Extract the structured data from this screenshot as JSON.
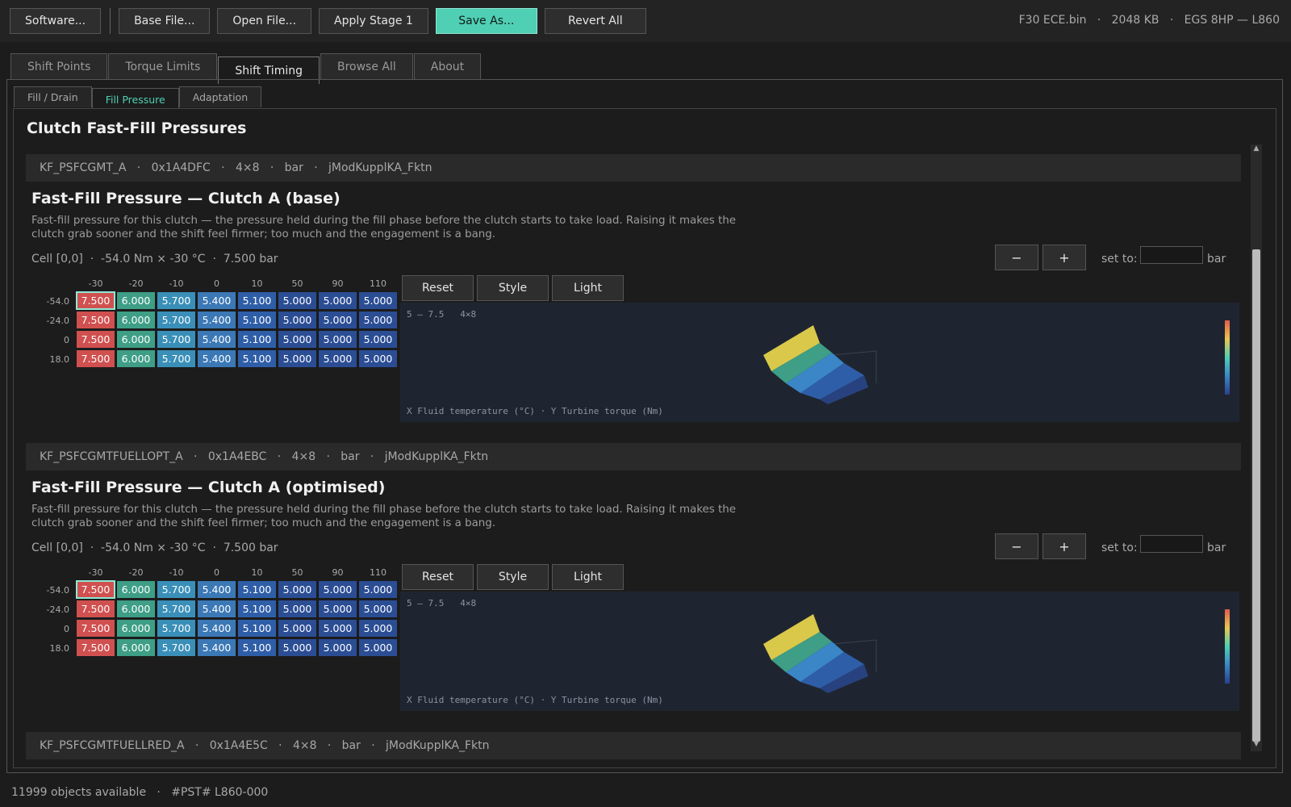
{
  "toolbar": {
    "software": "Software...",
    "base_file": "Base File...",
    "open_file": "Open File...",
    "apply_stage1": "Apply Stage 1",
    "save_as": "Save As...",
    "revert_all": "Revert All",
    "file_info": "F30 ECE.bin   ·   2048 KB   ·   EGS 8HP — L860",
    "accent": "#4fcfb3"
  },
  "tabs": [
    "Shift Points",
    "Torque Limits",
    "Shift Timing",
    "Browse All",
    "About"
  ],
  "active_tab": "Shift Timing",
  "subtabs": [
    "Fill / Drain",
    "Fill Pressure",
    "Adaptation"
  ],
  "active_subtab": "Fill Pressure",
  "page_title": "Clutch Fast-Fill Pressures",
  "maps": [
    {
      "header": "KF_PSFCGMT_A   ·   0x1A4DFC   ·   4×8   ·   bar   ·   jModKupplKA_Fktn",
      "title": "Fast-Fill Pressure — Clutch A (base)",
      "description": "Fast-fill pressure for this clutch — the pressure held during the fill phase before the clutch starts to take load. Raising it makes the clutch grab sooner and the shift feel firmer; too much and the engagement is a bang.",
      "cell_info": "Cell [0,0]  ·  -54.0 Nm × -30 °C  ·  7.500 bar",
      "minus": "−",
      "plus": "+",
      "set_to": "set to:",
      "unit": "bar",
      "reset": "Reset",
      "style": "Style",
      "light": "Light",
      "x_axis": [
        "-30",
        "-20",
        "-10",
        "0",
        "10",
        "50",
        "90",
        "110"
      ],
      "y_axis": [
        "-54.0",
        "-24.0",
        "0",
        "18.0"
      ],
      "values": [
        [
          "7.500",
          "6.000",
          "5.700",
          "5.400",
          "5.100",
          "5.000",
          "5.000",
          "5.000"
        ],
        [
          "7.500",
          "6.000",
          "5.700",
          "5.400",
          "5.100",
          "5.000",
          "5.000",
          "5.000"
        ],
        [
          "7.500",
          "6.000",
          "5.700",
          "5.400",
          "5.100",
          "5.000",
          "5.000",
          "5.000"
        ],
        [
          "7.500",
          "6.000",
          "5.700",
          "5.400",
          "5.100",
          "5.000",
          "5.000",
          "5.000"
        ]
      ],
      "viz_range": "5 – 7.5   4×8",
      "viz_axes": "X Fluid temperature (°C) · Y Turbine torque (Nm)"
    },
    {
      "header": "KF_PSFCGMTFUELLOPT_A   ·   0x1A4EBC   ·   4×8   ·   bar   ·   jModKupplKA_Fktn",
      "title": "Fast-Fill Pressure — Clutch A (optimised)",
      "description": "Fast-fill pressure for this clutch — the pressure held during the fill phase before the clutch starts to take load. Raising it makes the clutch grab sooner and the shift feel firmer; too much and the engagement is a bang.",
      "cell_info": "Cell [0,0]  ·  -54.0 Nm × -30 °C  ·  7.500 bar",
      "minus": "−",
      "plus": "+",
      "set_to": "set to:",
      "unit": "bar",
      "reset": "Reset",
      "style": "Style",
      "light": "Light",
      "x_axis": [
        "-30",
        "-20",
        "-10",
        "0",
        "10",
        "50",
        "90",
        "110"
      ],
      "y_axis": [
        "-54.0",
        "-24.0",
        "0",
        "18.0"
      ],
      "values": [
        [
          "7.500",
          "6.000",
          "5.700",
          "5.400",
          "5.100",
          "5.000",
          "5.000",
          "5.000"
        ],
        [
          "7.500",
          "6.000",
          "5.700",
          "5.400",
          "5.100",
          "5.000",
          "5.000",
          "5.000"
        ],
        [
          "7.500",
          "6.000",
          "5.700",
          "5.400",
          "5.100",
          "5.000",
          "5.000",
          "5.000"
        ],
        [
          "7.500",
          "6.000",
          "5.700",
          "5.400",
          "5.100",
          "5.000",
          "5.000",
          "5.000"
        ]
      ],
      "viz_range": "5 – 7.5   4×8",
      "viz_axes": "X Fluid temperature (°C) · Y Turbine torque (Nm)"
    }
  ],
  "next_map_header": "KF_PSFCGMTFUELLRED_A   ·   0x1A4E5C   ·   4×8   ·   bar   ·   jModKupplKA_Fktn",
  "cell_colors": {
    "7.500": "#d05050",
    "6.000": "#3e9e86",
    "5.700": "#3a8fb8",
    "5.400": "#3b78b6",
    "5.100": "#2f5ea8",
    "5.000": "#2b4d94"
  },
  "status": "11999 objects available   ·   #PST# L860-000"
}
